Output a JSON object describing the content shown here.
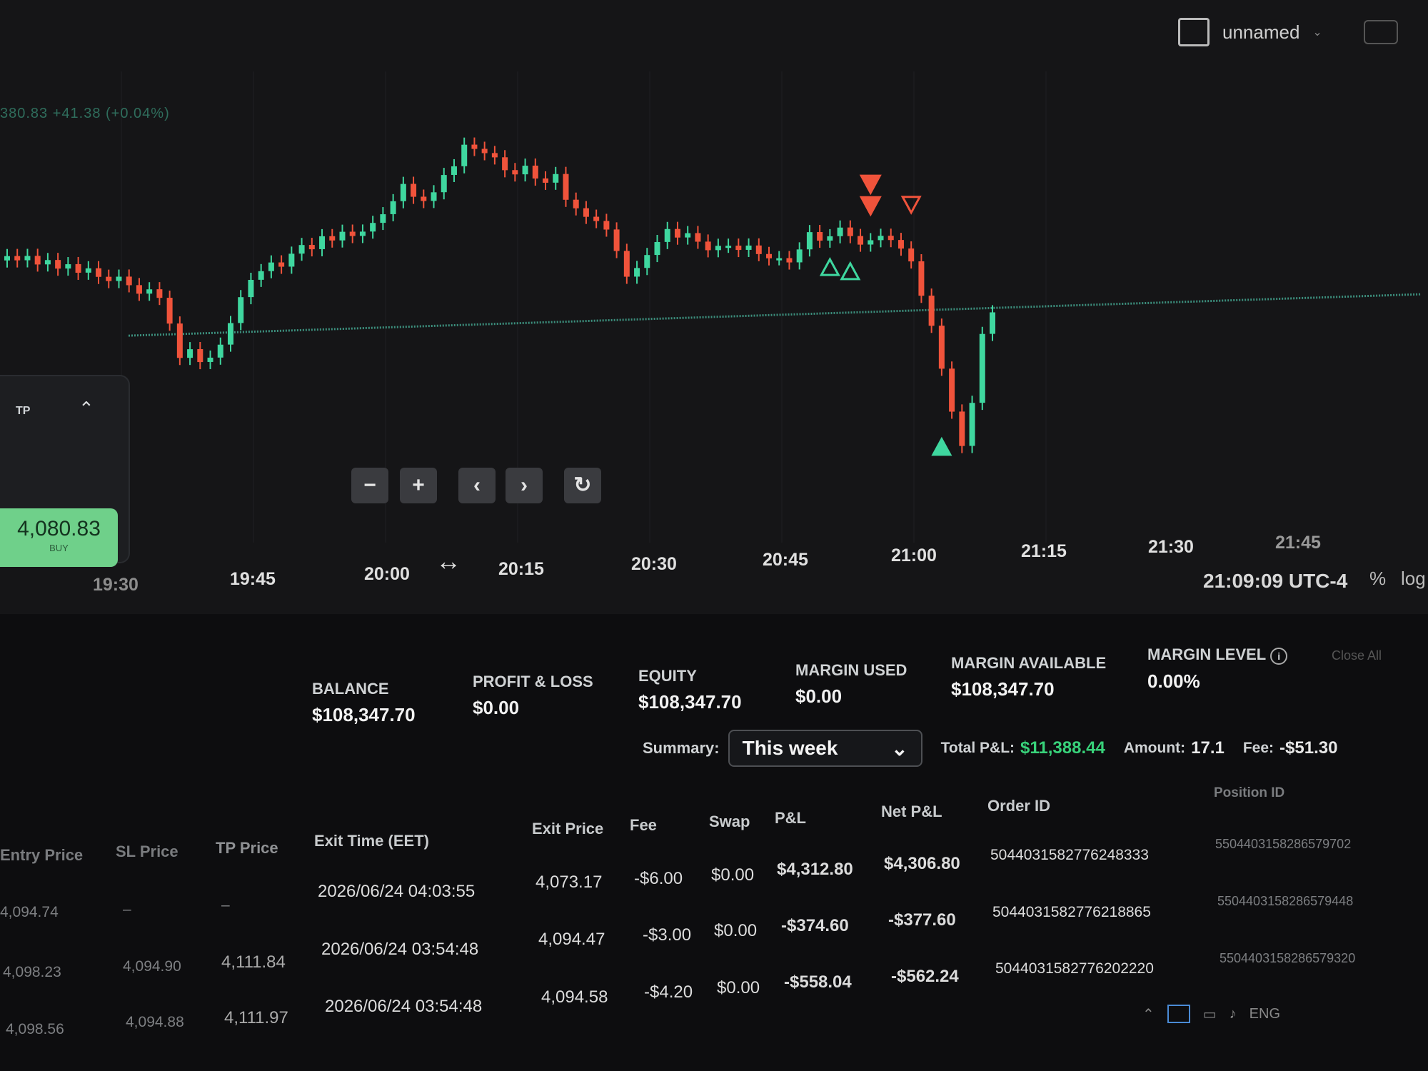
{
  "window": {
    "account_name": "unnamed",
    "theme_accent": "#38d27a",
    "bearish_color": "#ef4c47"
  },
  "chart": {
    "readout": "380.83 +41.38 (+0.04%)",
    "time_labels": [
      "19:30",
      "19:45",
      "20:00",
      "20:15",
      "20:30",
      "20:45",
      "21:00",
      "21:15",
      "21:30",
      "21:45"
    ],
    "clock": "21:09:09 UTC-4",
    "percent_label": "%",
    "log_label": "log",
    "tp_label": "TP",
    "current_price": "4,080.83",
    "current_side": "BUY",
    "controls": [
      "−",
      "+",
      "‹",
      "›",
      "↻"
    ]
  },
  "chart_data": {
    "type": "candlestick",
    "x_start": "19:30",
    "x_end": "21:09",
    "interval_minutes": 1,
    "closes": [
      4096,
      4095,
      4096,
      4094,
      4095,
      4093,
      4094,
      4092,
      4093,
      4091,
      4090,
      4091,
      4089,
      4087,
      4088,
      4086,
      4080,
      4072,
      4074,
      4071,
      4072,
      4075,
      4080,
      4086,
      4090,
      4092,
      4094,
      4093,
      4096,
      4098,
      4097,
      4100,
      4099,
      4101,
      4100,
      4101,
      4103,
      4105,
      4108,
      4112,
      4109,
      4108,
      4110,
      4114,
      4116,
      4121,
      4120,
      4119,
      4118,
      4115,
      4114,
      4116,
      4113,
      4112,
      4114,
      4108,
      4106,
      4104,
      4103,
      4101,
      4096,
      4090,
      4092,
      4095,
      4098,
      4101,
      4099,
      4100,
      4098,
      4096,
      4097,
      4097,
      4096,
      4097,
      4095,
      4094,
      4094,
      4093,
      4096,
      4100,
      4098,
      4099,
      4101,
      4099,
      4097,
      4098,
      4099,
      4098,
      4096,
      4093,
      4085,
      4078,
      4068,
      4058,
      4050,
      4060,
      4076,
      4081
    ],
    "markers": [
      {
        "type": "buy",
        "time": "20:51",
        "price": 4092
      },
      {
        "type": "buy",
        "time": "20:53",
        "price": 4091
      },
      {
        "type": "sell",
        "time": "20:55",
        "price": 4111
      },
      {
        "type": "sell",
        "time": "20:55",
        "price": 4106
      },
      {
        "type": "close",
        "time": "20:59",
        "price": 4106
      },
      {
        "type": "buy",
        "time": "21:02",
        "price": 4050
      }
    ],
    "position_line": 4080.83
  },
  "account": {
    "balance_label": "BALANCE",
    "balance": "$108,347.70",
    "pnl_label": "PROFIT & LOSS",
    "pnl": "$0.00",
    "equity_label": "EQUITY",
    "equity": "$108,347.70",
    "margin_used_label": "MARGIN USED",
    "margin_used": "$0.00",
    "margin_available_label": "MARGIN AVAILABLE",
    "margin_available": "$108,347.70",
    "margin_level_label": "MARGIN LEVEL",
    "margin_level": "0.00%",
    "close_all": "Close All"
  },
  "summary": {
    "label": "Summary:",
    "period": "This week",
    "total_pnl_label": "Total P&L:",
    "total_pnl": "$11,388.44",
    "amount_label": "Amount:",
    "amount": "17.1",
    "fee_label": "Fee:",
    "fee": "-$51.30"
  },
  "table": {
    "headers": {
      "entry": "Entry Price",
      "sl": "SL Price",
      "tp": "TP Price",
      "exit_time": "Exit Time (EET)",
      "exit_price": "Exit Price",
      "fee": "Fee",
      "swap": "Swap",
      "pnl": "P&L",
      "net_pnl": "Net P&L",
      "order_id": "Order ID",
      "position_id": "Position ID"
    },
    "rows": [
      {
        "entry": "4,094.74",
        "sl": "–",
        "tp": "–",
        "exit_time": "2026/06/24 04:03:55",
        "exit_price": "4,073.17",
        "fee": "-$6.00",
        "swap": "$0.00",
        "pnl": "$4,312.80",
        "net_pnl": "$4,306.80",
        "order_id": "5044031582776248333",
        "position_id": "5504403158286579702"
      },
      {
        "entry": "4,098.23",
        "sl": "4,094.90",
        "tp": "4,111.84",
        "exit_time": "2026/06/24 03:54:48",
        "exit_price": "4,094.47",
        "fee": "-$3.00",
        "swap": "$0.00",
        "pnl": "-$374.60",
        "net_pnl": "-$377.60",
        "order_id": "5044031582776218865",
        "position_id": "5504403158286579448"
      },
      {
        "entry": "4,098.56",
        "sl": "4,094.88",
        "tp": "4,111.97",
        "exit_time": "2026/06/24 03:54:48",
        "exit_price": "4,094.58",
        "fee": "-$4.20",
        "swap": "$0.00",
        "pnl": "-$558.04",
        "net_pnl": "-$562.24",
        "order_id": "5044031582776202220",
        "position_id": "5504403158286579320"
      }
    ]
  },
  "taskbar": {
    "lang": "ENG"
  }
}
